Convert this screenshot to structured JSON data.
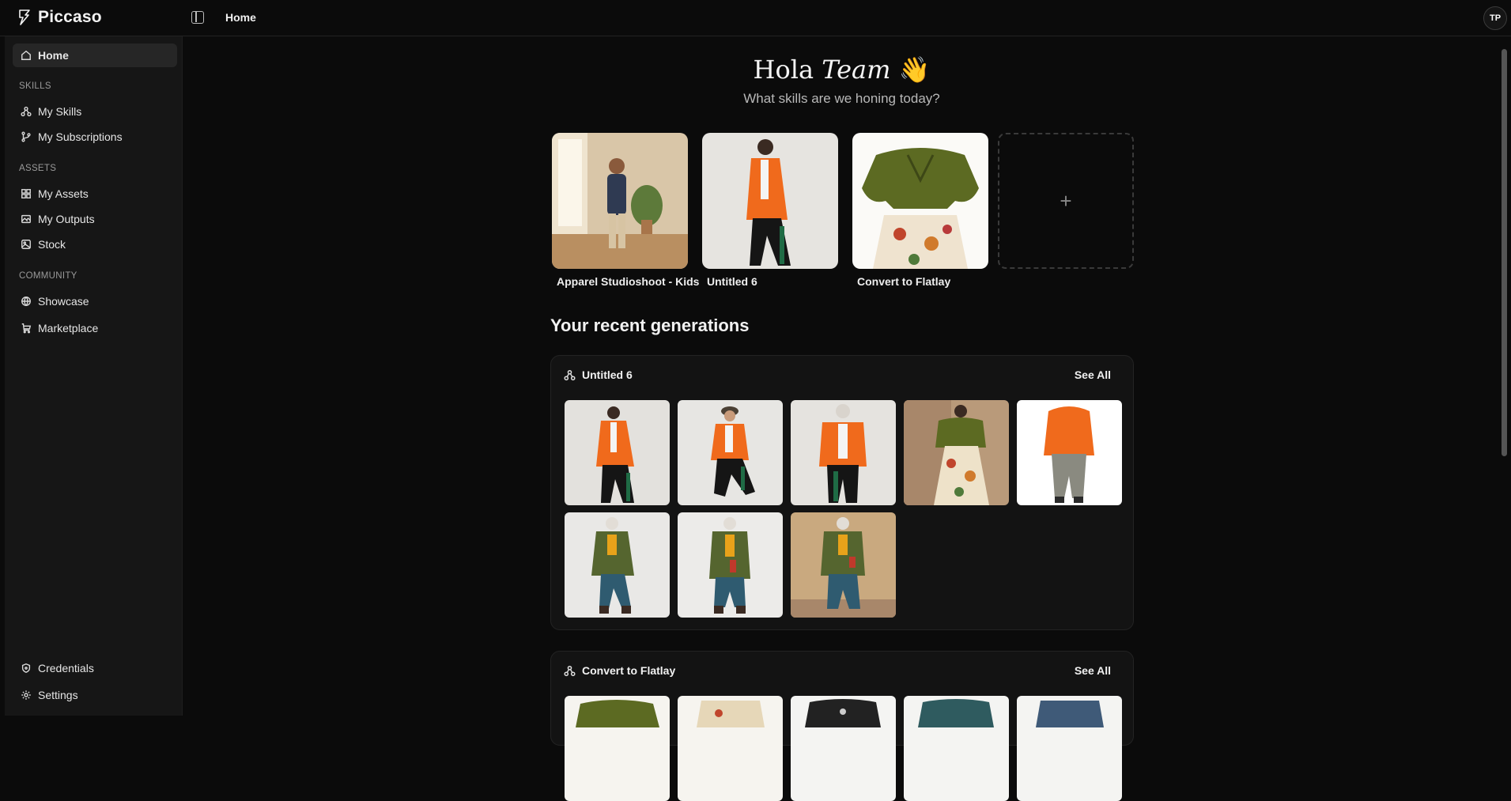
{
  "app": {
    "name": "Piccaso"
  },
  "header": {
    "breadcrumb": "Home",
    "avatar_initials": "TP"
  },
  "sidebar": {
    "home": "Home",
    "sections": {
      "skills": "SKILLS",
      "assets": "ASSETS",
      "community": "COMMUNITY"
    },
    "items": {
      "my_skills": "My Skills",
      "my_subscriptions": "My Subscriptions",
      "my_assets": "My Assets",
      "my_outputs": "My Outputs",
      "stock": "Stock",
      "showcase": "Showcase",
      "marketplace": "Marketplace",
      "credentials": "Credentials",
      "settings": "Settings"
    }
  },
  "greeting": {
    "hola": "Hola",
    "name": "Team",
    "emoji": "👋",
    "subtitle": "What skills are we honing today?"
  },
  "skills": [
    {
      "label": "Apparel Studioshoot - Kids"
    },
    {
      "label": "Untitled 6"
    },
    {
      "label": "Convert to Flatlay"
    }
  ],
  "add_skill_icon": "+",
  "recent": {
    "title": "Your recent generations",
    "groups": [
      {
        "name": "Untitled 6",
        "see_all": "See All"
      },
      {
        "name": "Convert to Flatlay",
        "see_all": "See All"
      }
    ]
  },
  "icons": {
    "home": "home-icon",
    "skills": "skill-nodes-icon",
    "subscriptions": "git-branch-icon",
    "assets": "grid-icon",
    "outputs": "image-icon",
    "stock": "photo-icon",
    "showcase": "globe-icon",
    "marketplace": "cart-icon",
    "credentials": "shield-icon",
    "settings": "gear-icon"
  },
  "colors": {
    "accent_orange": "#f06a1c",
    "olive": "#5c6a22",
    "background": "#0b0b0b"
  }
}
